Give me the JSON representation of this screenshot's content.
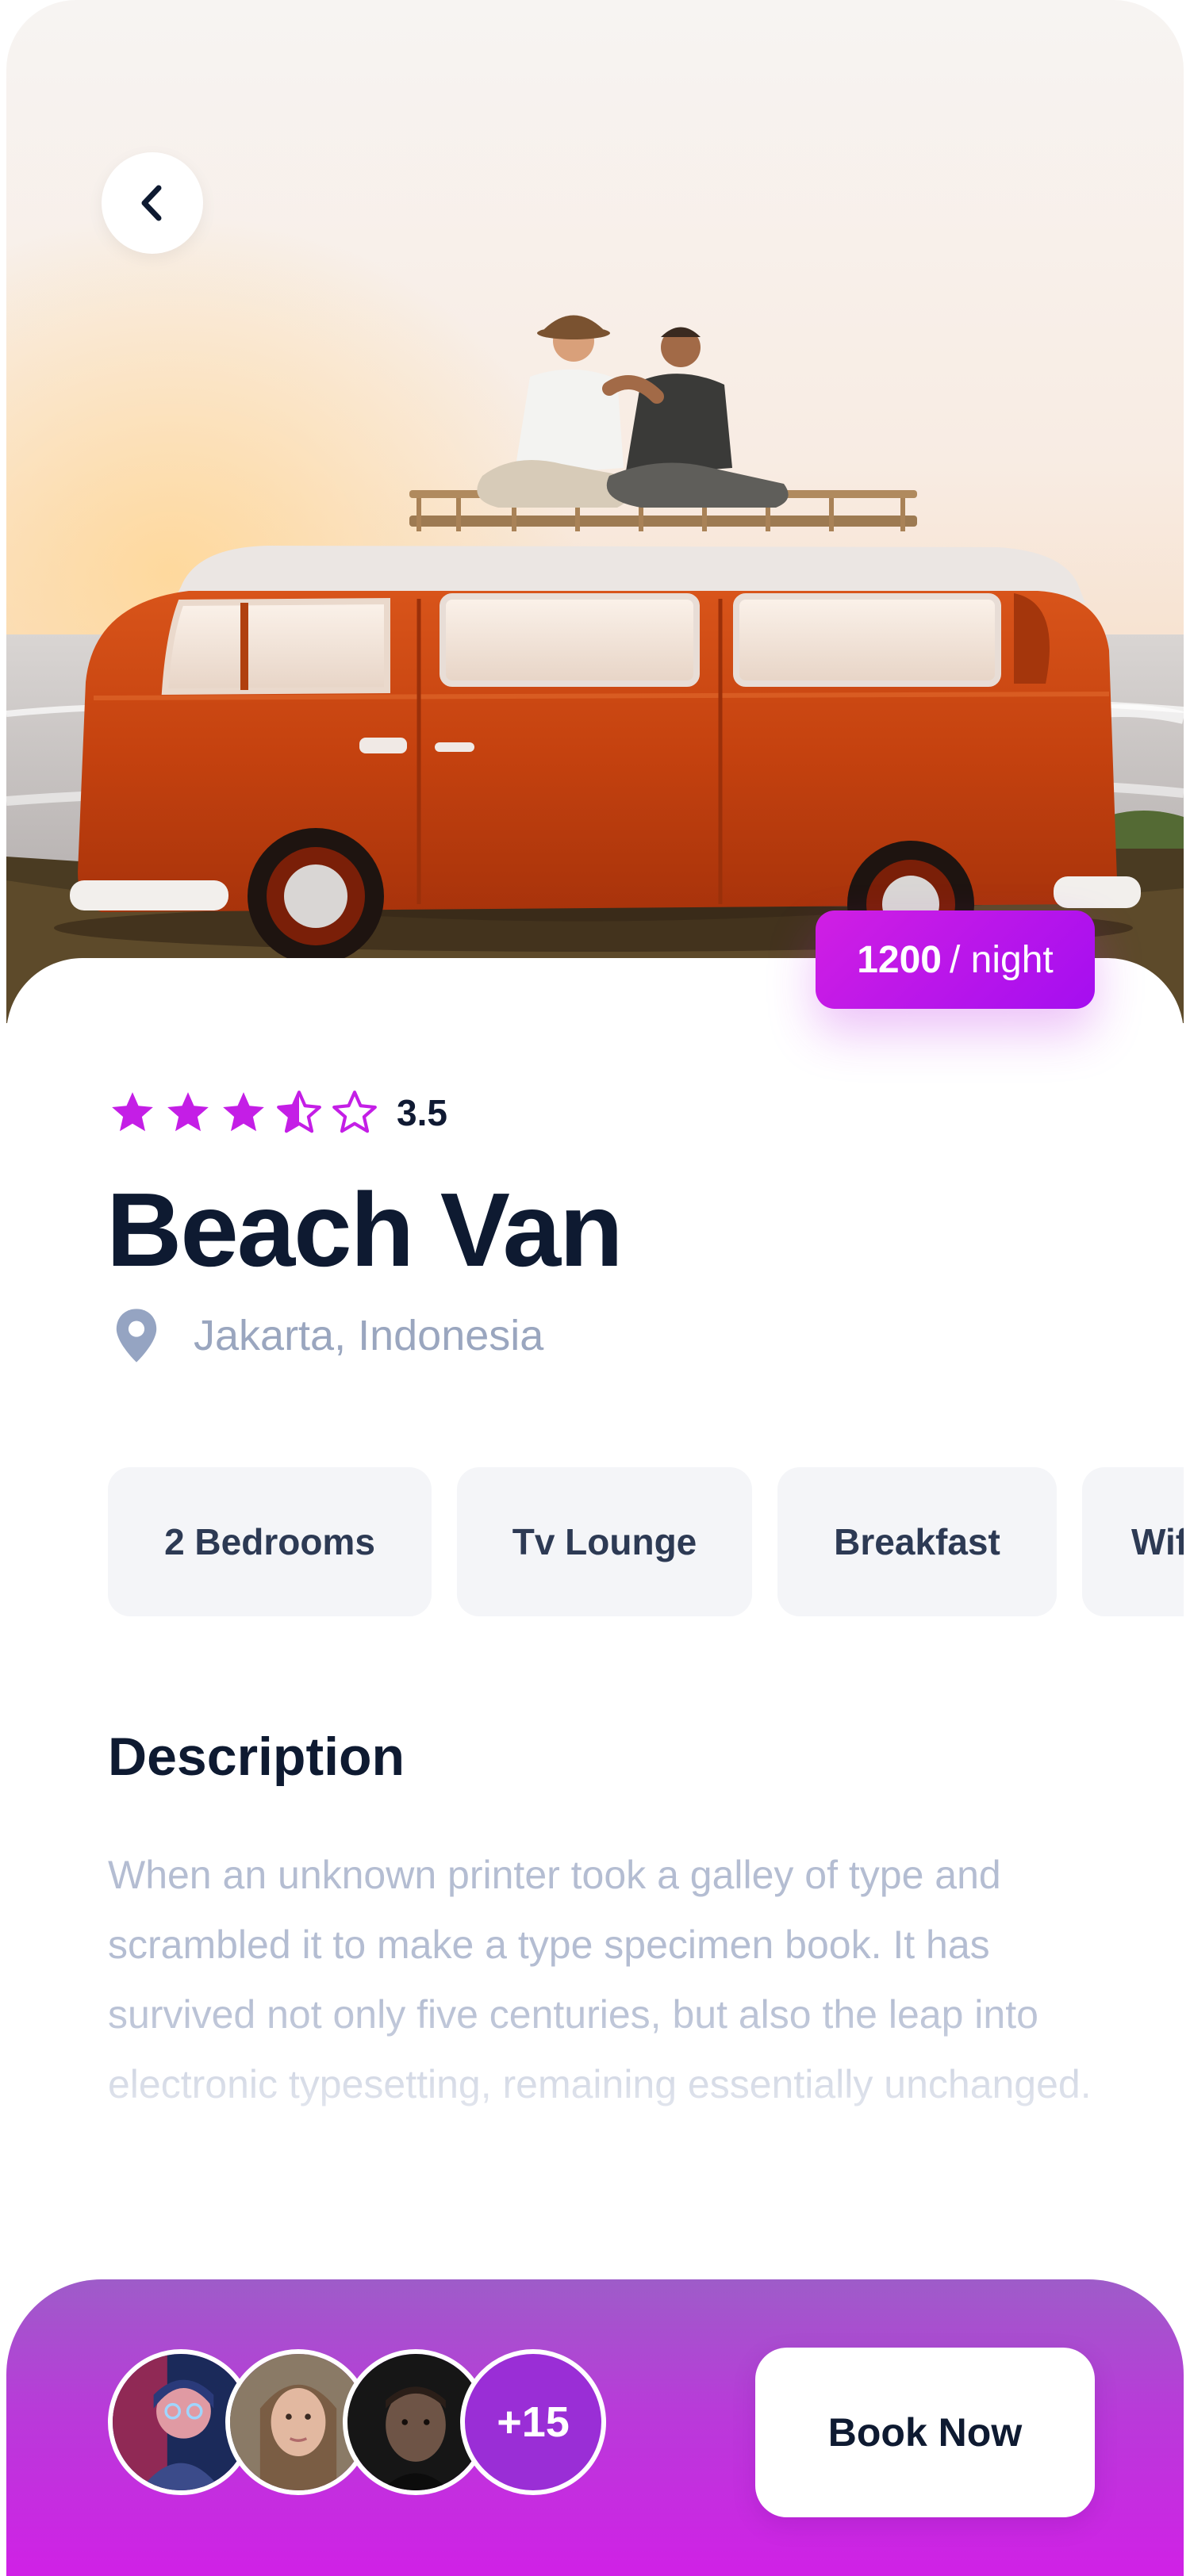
{
  "listing": {
    "title": "Beach Van",
    "location": "Jakarta, Indonesia",
    "rating": 3.5,
    "rating_label": "3.5",
    "price_amount": "1200",
    "price_unit": "/ night"
  },
  "amenities": [
    {
      "label": "2 Bedrooms"
    },
    {
      "label": "Tv Lounge"
    },
    {
      "label": "Breakfast"
    },
    {
      "label": "Wif"
    }
  ],
  "description": {
    "heading": "Description",
    "text": "When an unknown printer took a galley of type and scrambled it to make a type specimen book. It has survived not only five centuries, but also the leap into electronic typesetting, remaining essentially unchanged."
  },
  "bottom_bar": {
    "more_guests_label": "+15",
    "book_label": "Book Now"
  },
  "icons": {
    "back": "chevron-left-icon",
    "star": "star-icon",
    "location": "map-pin-icon"
  },
  "colors": {
    "accent": "#c41ee6",
    "accent_dark": "#a50ef0",
    "title_text": "#0e1a31",
    "muted_text": "#9aa6bf",
    "chip_bg": "#f4f5f8",
    "van_orange": "#c9410f"
  }
}
